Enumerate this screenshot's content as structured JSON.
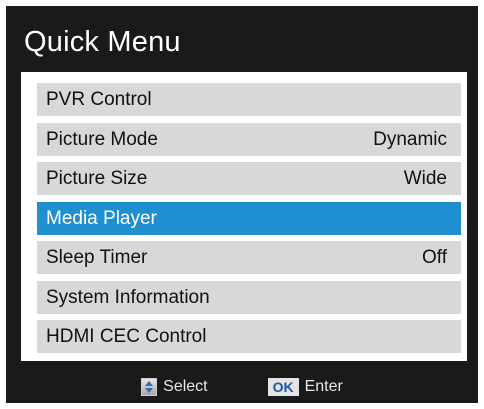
{
  "menu": {
    "title": "Quick Menu",
    "items": [
      {
        "label": "PVR Control",
        "value": ""
      },
      {
        "label": "Picture Mode",
        "value": "Dynamic"
      },
      {
        "label": "Picture Size",
        "value": "Wide"
      },
      {
        "label": "Media Player",
        "value": ""
      },
      {
        "label": "Sleep Timer",
        "value": "Off"
      },
      {
        "label": "System Information",
        "value": ""
      },
      {
        "label": "HDMI CEC Control",
        "value": ""
      }
    ],
    "selected_index": 3
  },
  "footer": {
    "select_label": "Select",
    "ok_key": "OK",
    "enter_label": "Enter"
  },
  "icons": {
    "navigate": "up-down-arrows-icon",
    "confirm": "ok-key-icon"
  },
  "colors": {
    "background": "#1a1a1a",
    "item_background": "#d8d8d8",
    "selected_background": "#1f8fcf"
  }
}
